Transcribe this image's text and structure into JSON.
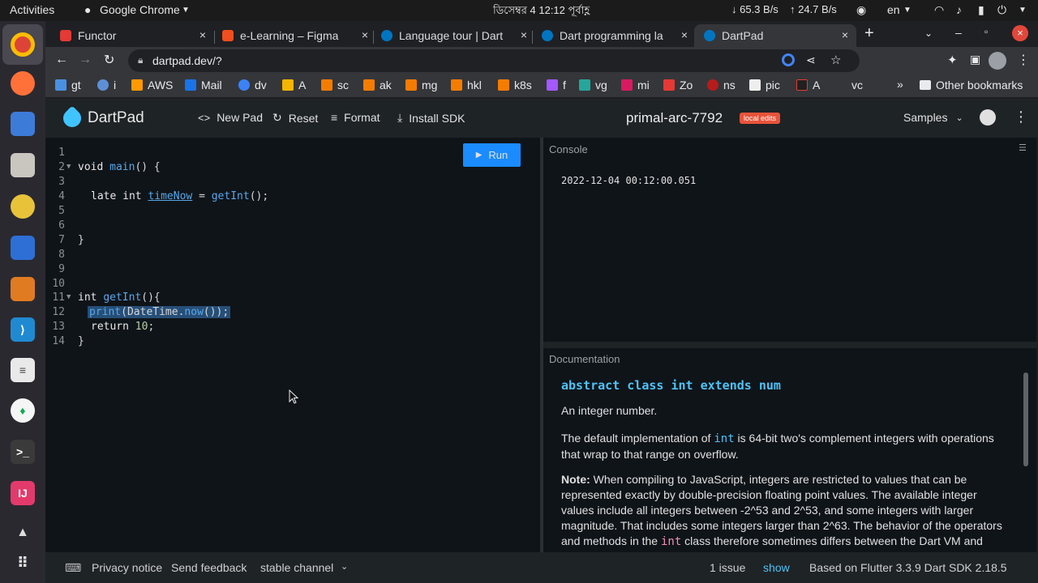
{
  "system": {
    "activities": "Activities",
    "app_name": "Google Chrome",
    "clock": "ডিসেম্বর 4  12:12 পূর্বাহ্ণ",
    "net_down": "↓ 65.3 B/s",
    "net_up": "↑ 24.7 B/s",
    "lang": "en"
  },
  "tabs": [
    {
      "label": "Functor",
      "close": "×"
    },
    {
      "label": "e-Learning – Figma",
      "close": "×"
    },
    {
      "label": "Language tour | Dart",
      "close": "×"
    },
    {
      "label": "Dart programming la",
      "close": "×"
    },
    {
      "label": "DartPad",
      "close": "×"
    }
  ],
  "browser": {
    "url": "dartpad.dev/?",
    "new_tab": "+",
    "bookmarks": [
      "gt",
      "i",
      "AWS",
      "Mail",
      "dv",
      "A",
      "sc",
      "ak",
      "mg",
      "hkl",
      "k8s",
      "f",
      "vg",
      "mi",
      "Zo",
      "ns",
      "pic",
      "A",
      "vc"
    ],
    "more": "»",
    "other_bookmarks": "Other bookmarks"
  },
  "dartpad": {
    "logo": "DartPad",
    "new_pad": "New Pad",
    "reset": "Reset",
    "format": "Format",
    "install_sdk": "Install SDK",
    "pad_name": "primal-arc-7792",
    "badge": "local edits",
    "samples": "Samples",
    "run": "Run"
  },
  "editor": {
    "lines": [
      "1",
      "2",
      "3",
      "4",
      "5",
      "6",
      "7",
      "8",
      "9",
      "10",
      "11",
      "12",
      "13",
      "14"
    ],
    "code": {
      "l2a": "void ",
      "l2b": "main",
      "l2c": "() {",
      "l4a": "late int ",
      "l4b": "timeNow",
      "l4c": " = ",
      "l4d": "getInt",
      "l4e": "();",
      "l7": "}",
      "l11a": "int ",
      "l11b": "getInt",
      "l11c": "(){",
      "l12a": "print",
      "l12b": "(DateTime.",
      "l12c": "now",
      "l12d": "());",
      "l13a": "return ",
      "l13b": "10",
      "l13c": ";",
      "l14": "}"
    }
  },
  "console": {
    "title": "Console",
    "output": "2022-12-04 00:12:00.051"
  },
  "docs": {
    "title": "Documentation",
    "heading": "abstract class int extends num",
    "p1": "An integer number.",
    "p2a": "The default implementation of ",
    "p2b": "int",
    "p2c": " is 64-bit two's complement integers with operations that wrap to that range on overflow.",
    "p3a": "Note:",
    "p3b": " When compiling to JavaScript, integers are restricted to values that can be represented exactly by double-precision floating point values. The available integer values include all integers between -2^53 and 2^53, and some integers with larger magnitude. That includes some integers larger than 2^63. The behavior of the operators and methods in the ",
    "p3c": "int",
    "p3d": " class therefore sometimes differs between the Dart VM and Dart code compiled to JavaScript."
  },
  "footer": {
    "privacy": "Privacy notice",
    "feedback": "Send feedback",
    "channel": "stable channel",
    "issues": "1 issue",
    "show": "show",
    "version": "Based on Flutter 3.3.9 Dart SDK 2.18.5"
  },
  "colors": {
    "run_button": "#1a8cff",
    "badge": "#e8533a",
    "accent_link": "#4fc3f7"
  }
}
